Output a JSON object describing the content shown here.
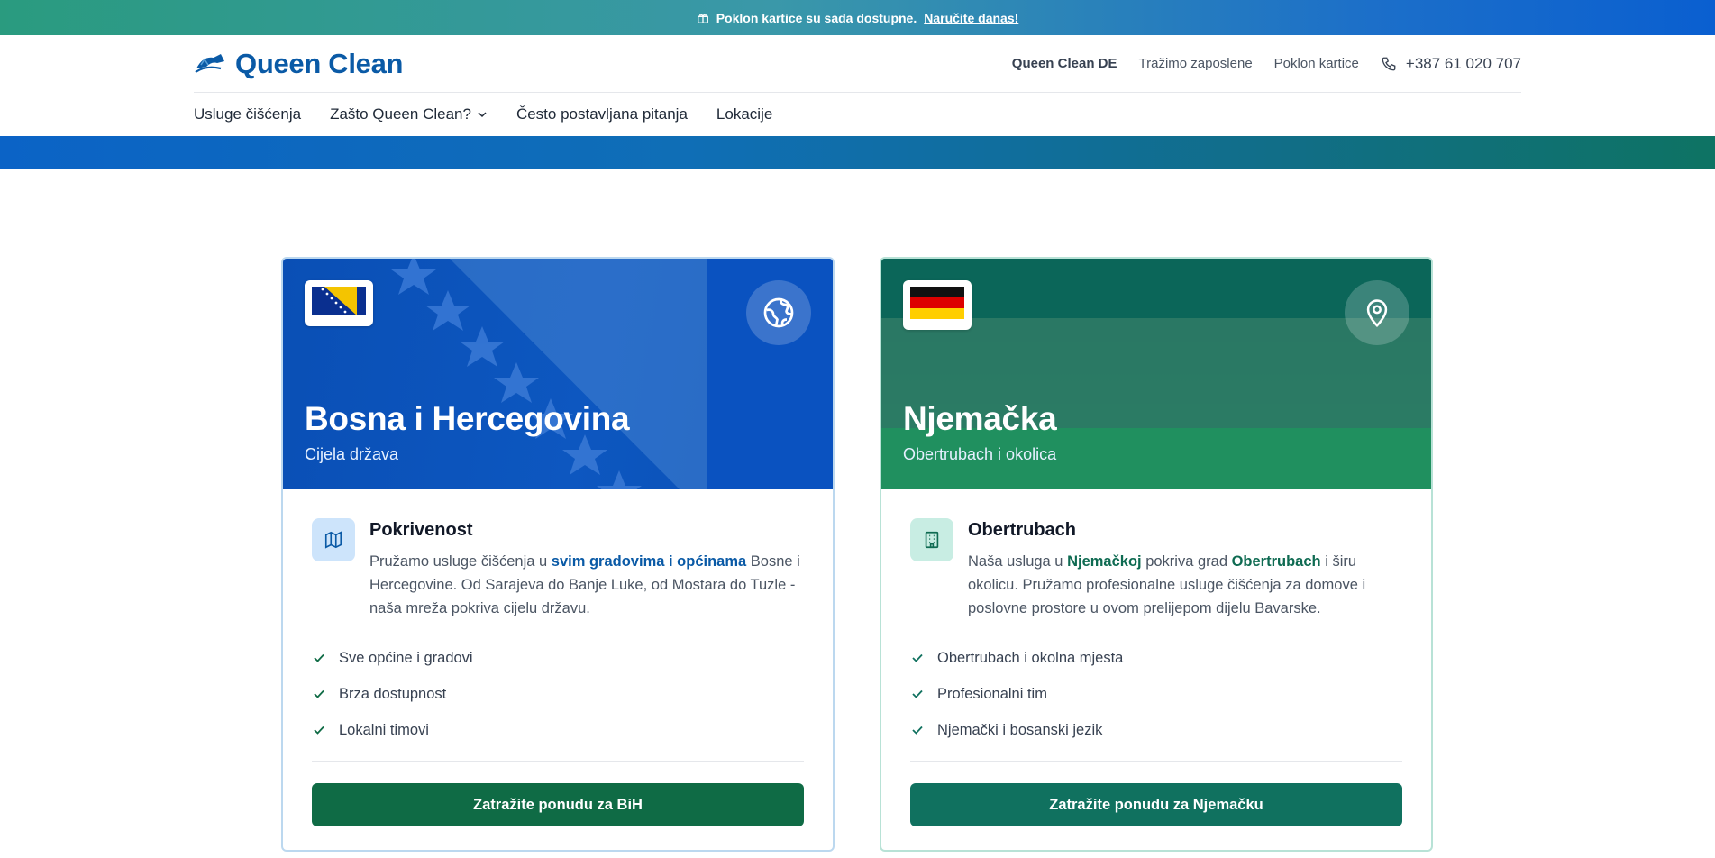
{
  "announcement": {
    "text": "Poklon kartice su sada dostupne.",
    "link": "Naručite danas!"
  },
  "header": {
    "logo_text": "Queen Clean",
    "links": [
      "Queen Clean DE",
      "Tražimo zaposlene",
      "Poklon kartice"
    ],
    "phone": "+387 61 020 707"
  },
  "nav": {
    "items": [
      "Usluge čišćenja",
      "Zašto Queen Clean?",
      "Često postavljana pitanja",
      "Lokacije"
    ]
  },
  "cards": [
    {
      "title": "Bosna i Hercegovina",
      "subtitle": "Cijela država",
      "feature_title": "Pokrivenost",
      "desc_parts": [
        "Pružamo usluge čišćenja u ",
        "svim gradovima i općinama",
        " Bosne i Hercegovine. Od Sarajeva do Banje Luke, od Mostara do Tuzle - naša mreža pokriva cijelu državu."
      ],
      "checks": [
        "Sve općine i gradovi",
        "Brza dostupnost",
        "Lokalni timovi"
      ],
      "cta": "Zatražite ponudu za BiH"
    },
    {
      "title": "Njemačka",
      "subtitle": "Obertrubach i okolica",
      "feature_title": "Obertrubach",
      "desc_parts": [
        "Naša usluga u ",
        "Njemačkoj",
        " pokriva grad ",
        "Obertrubach",
        " i širu okolicu. Pružamo profesionalne usluge čišćenja za domove i poslovne prostore u ovom prelijepom dijelu Bavarske."
      ],
      "checks": [
        "Obertrubach i okolna mjesta",
        "Profesionalni tim",
        "Njemački i bosanski jezik"
      ],
      "cta": "Zatražite ponudu za Njemačku"
    }
  ],
  "colors": {
    "brand_blue": "#0a5aa6",
    "bih_cta": "#0f6b45",
    "de_cta": "#10715f"
  }
}
